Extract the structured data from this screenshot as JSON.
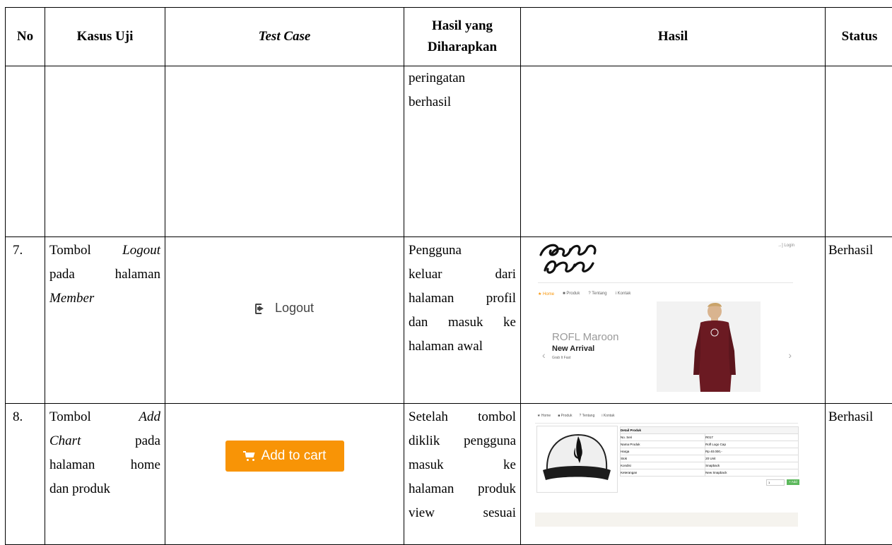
{
  "headers": {
    "no": "No",
    "kasus_uji": "Kasus Uji",
    "test_case": "Test Case",
    "hasil_diharapkan_1": "Hasil yang",
    "hasil_diharapkan_2": "Diharapkan",
    "hasil": "Hasil",
    "status": "Status"
  },
  "row_cont": {
    "expected_lines": [
      "peringatan",
      "berhasil"
    ]
  },
  "row7": {
    "no": "7.",
    "kasus_1a": "Tombol",
    "kasus_1b": "Logout",
    "kasus_2a": "pada",
    "kasus_2b": "halaman",
    "kasus_3": "Member",
    "test_case_label": "Logout",
    "expected_lines": [
      "Pengguna",
      "keluar dari",
      "halaman profil",
      "dan masuk ke",
      "halaman awal"
    ],
    "status": "Berhasil",
    "screenshot": {
      "login": "Login",
      "nav": [
        "Home",
        "Produk",
        "Tentang",
        "Kontak"
      ],
      "title": "ROFL Maroon",
      "subtitle": "New Arrival",
      "small": "Grab It Fast",
      "prev": "‹",
      "next": "›"
    }
  },
  "row8": {
    "no": "8.",
    "kasus_1a": "Tombol",
    "kasus_1b": "Add",
    "kasus_2a": "Chart",
    "kasus_2b": "pada",
    "kasus_3a": "halaman",
    "kasus_3b": "home",
    "kasus_4": "dan produk",
    "test_case_label": "Add to cart",
    "expected_lines": [
      "Setelah tombol",
      "diklik pengguna",
      "masuk ke",
      "halaman produk",
      "view sesuai"
    ],
    "status": "Berhasil",
    "screenshot": {
      "nav": [
        "Home",
        "Produk",
        "Tentang",
        "Kontak"
      ],
      "detail_title": "Detail Produk",
      "rows": [
        [
          "No. Seri",
          "R017"
        ],
        [
          "Nama Produk",
          "Rofl Logo Cap"
        ],
        [
          "Harga",
          "Rp 40.000,-"
        ],
        [
          "Stok",
          "20 Unit"
        ],
        [
          "Kondisi",
          "Snapback"
        ],
        [
          "Keterangan",
          "New Snapback"
        ]
      ],
      "qty": "1",
      "add_label": "+ Add"
    }
  }
}
